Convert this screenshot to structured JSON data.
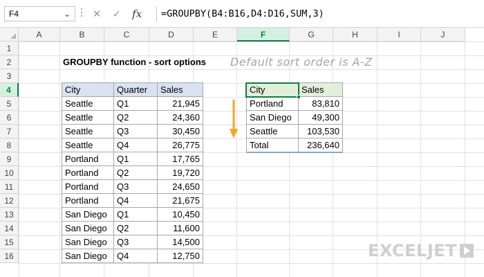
{
  "formula_bar": {
    "name_box": "F4",
    "cancel_glyph": "✕",
    "enter_glyph": "✓",
    "fx_label": "fx",
    "formula": "=GROUPBY(B4:B16,D4:D16,SUM,3)"
  },
  "columns": [
    "A",
    "B",
    "C",
    "D",
    "E",
    "F",
    "G",
    "H",
    "I",
    "J"
  ],
  "selected_column": "F",
  "rows": [
    "1",
    "2",
    "3",
    "4",
    "5",
    "6",
    "7",
    "8",
    "9",
    "10",
    "11",
    "12",
    "13",
    "14",
    "15",
    "16"
  ],
  "selected_row": "4",
  "sheet": {
    "title": "GROUPBY function - sort options",
    "note": "Default sort order is A-Z",
    "source_table": {
      "headers": [
        "City",
        "Quarter",
        "Sales"
      ],
      "rows": [
        [
          "Seattle",
          "Q1",
          "21,945"
        ],
        [
          "Seattle",
          "Q2",
          "24,360"
        ],
        [
          "Seattle",
          "Q3",
          "30,450"
        ],
        [
          "Seattle",
          "Q4",
          "26,775"
        ],
        [
          "Portland",
          "Q1",
          "17,765"
        ],
        [
          "Portland",
          "Q2",
          "19,720"
        ],
        [
          "Portland",
          "Q3",
          "24,650"
        ],
        [
          "Portland",
          "Q4",
          "21,675"
        ],
        [
          "San Diego",
          "Q1",
          "10,450"
        ],
        [
          "San Diego",
          "Q2",
          "11,600"
        ],
        [
          "San Diego",
          "Q3",
          "14,500"
        ],
        [
          "San Diego",
          "Q4",
          "12,750"
        ]
      ]
    },
    "result_table": {
      "headers": [
        "City",
        "Sales"
      ],
      "rows": [
        [
          "Portland",
          "83,810"
        ],
        [
          "San Diego",
          "49,300"
        ],
        [
          "Seattle",
          "103,530"
        ],
        [
          "Total",
          "236,640"
        ]
      ]
    }
  },
  "logo": {
    "text": "EXCELJET"
  },
  "colors": {
    "accent": "#107c41",
    "header_blue": "#d9e1f2",
    "header_green": "#e2efda",
    "arrow": "#f5a623"
  },
  "icons": {
    "arrow": "down-arrow-icon",
    "logo_mark": "exceljet-logo-icon"
  }
}
